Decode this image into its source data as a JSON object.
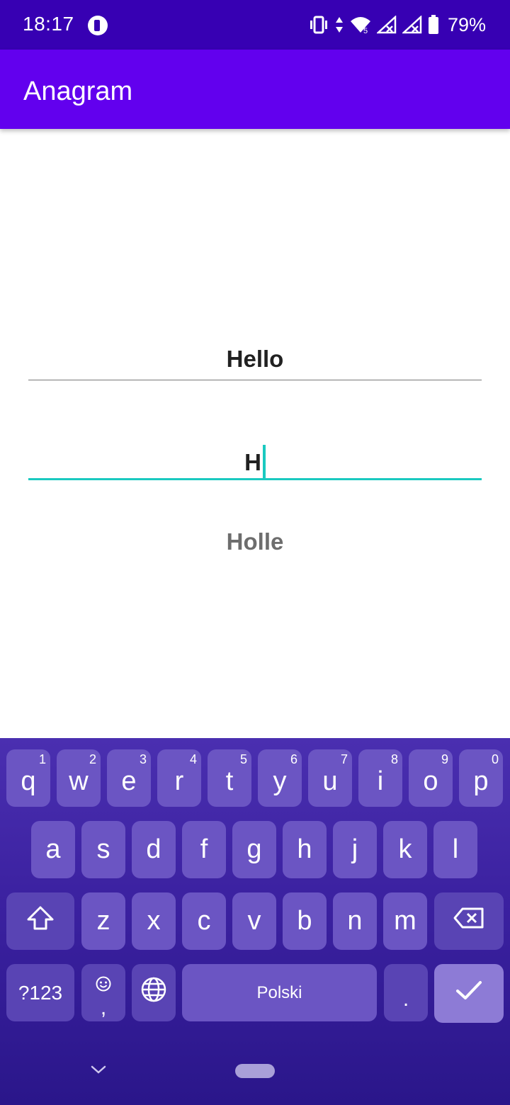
{
  "status_bar": {
    "time": "18:17",
    "battery_percent": "79%",
    "icons": [
      "app-notification-icon",
      "vibrate-icon",
      "data-arrows-icon",
      "wifi-icon",
      "signal-icon",
      "signal-icon",
      "battery-icon"
    ],
    "colors": {
      "background": "#3700b3"
    }
  },
  "app_bar": {
    "title": "Anagram",
    "color": "#6200ee"
  },
  "content": {
    "source_word": "Hello",
    "input_value": "H",
    "result_word": "Holle",
    "accent_color": "#1ac9c0"
  },
  "keyboard": {
    "row1": [
      {
        "letter": "q",
        "number": "1"
      },
      {
        "letter": "w",
        "number": "2"
      },
      {
        "letter": "e",
        "number": "3"
      },
      {
        "letter": "r",
        "number": "4"
      },
      {
        "letter": "t",
        "number": "5"
      },
      {
        "letter": "y",
        "number": "6"
      },
      {
        "letter": "u",
        "number": "7"
      },
      {
        "letter": "i",
        "number": "8"
      },
      {
        "letter": "o",
        "number": "9"
      },
      {
        "letter": "p",
        "number": "0"
      }
    ],
    "row2": [
      "a",
      "s",
      "d",
      "f",
      "g",
      "h",
      "j",
      "k",
      "l"
    ],
    "row3": [
      "z",
      "x",
      "c",
      "v",
      "b",
      "n",
      "m"
    ],
    "symbols_label": "?123",
    "emoji_comma": ",",
    "space_label": "Polski",
    "period_label": ".",
    "icons": [
      "shift-icon",
      "backspace-icon",
      "emoji-icon",
      "globe-icon",
      "check-icon",
      "chevron-down-icon"
    ]
  }
}
